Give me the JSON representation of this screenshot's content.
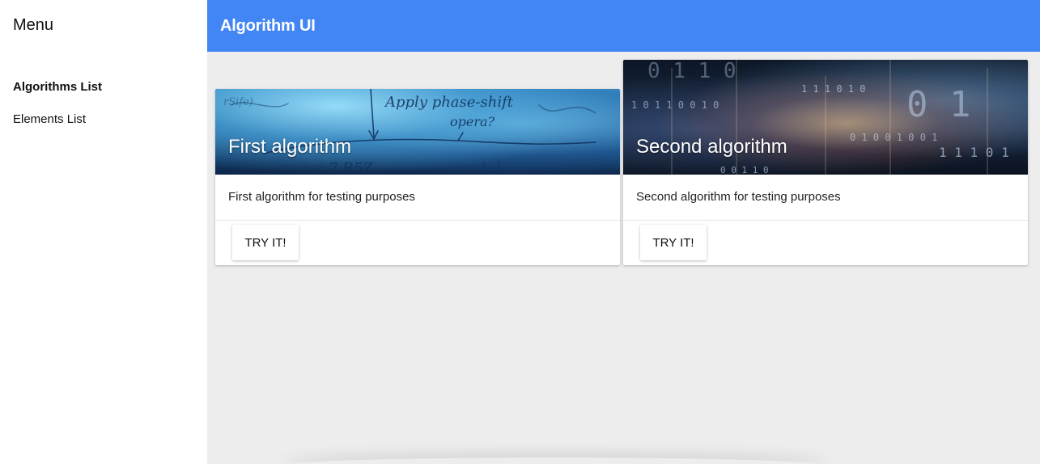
{
  "sidebar": {
    "title": "Menu",
    "items": [
      {
        "label": "Algorithms List",
        "active": true
      },
      {
        "label": "Elements List",
        "active": false
      }
    ]
  },
  "appbar": {
    "title": "Algorithm UI",
    "color": "#4285f4"
  },
  "cards": [
    {
      "title": "First algorithm",
      "description": "First algorithm for testing purposes",
      "button": "TRY IT!",
      "image_handwriting": [
        "Apply phase-shift",
        "opera?",
        "frequen",
        "7 R5Z",
        "rSife)"
      ]
    },
    {
      "title": "Second algorithm",
      "description": "Second algorithm for testing purposes",
      "button": "TRY IT!",
      "image_digits": [
        "0 1 1 0",
        "0 1",
        "1 0 1 1 0 0 1 0",
        "1 1 1 0 1 0",
        "0 1 0 0 1 0 0 1",
        "1 1 1 0 1",
        "0 0 1 1 0"
      ]
    }
  ]
}
